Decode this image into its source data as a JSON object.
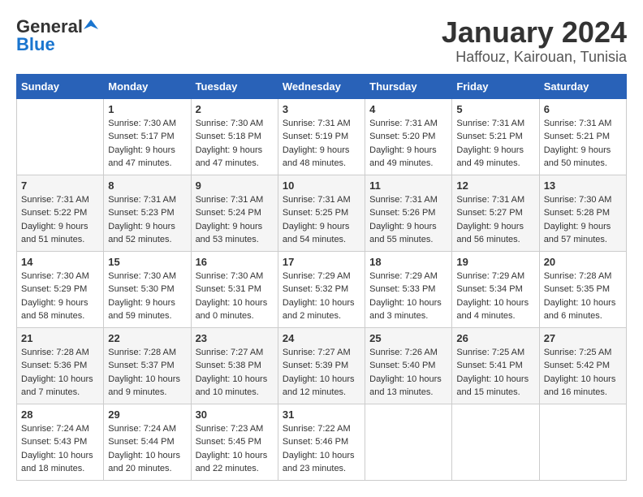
{
  "header": {
    "logo_general": "General",
    "logo_blue": "Blue",
    "month_title": "January 2024",
    "location": "Haffouz, Kairouan, Tunisia"
  },
  "days_of_week": [
    "Sunday",
    "Monday",
    "Tuesday",
    "Wednesday",
    "Thursday",
    "Friday",
    "Saturday"
  ],
  "weeks": [
    [
      {
        "day": "",
        "sunrise": "",
        "sunset": "",
        "daylight": ""
      },
      {
        "day": "1",
        "sunrise": "Sunrise: 7:30 AM",
        "sunset": "Sunset: 5:17 PM",
        "daylight": "Daylight: 9 hours and 47 minutes."
      },
      {
        "day": "2",
        "sunrise": "Sunrise: 7:30 AM",
        "sunset": "Sunset: 5:18 PM",
        "daylight": "Daylight: 9 hours and 47 minutes."
      },
      {
        "day": "3",
        "sunrise": "Sunrise: 7:31 AM",
        "sunset": "Sunset: 5:19 PM",
        "daylight": "Daylight: 9 hours and 48 minutes."
      },
      {
        "day": "4",
        "sunrise": "Sunrise: 7:31 AM",
        "sunset": "Sunset: 5:20 PM",
        "daylight": "Daylight: 9 hours and 49 minutes."
      },
      {
        "day": "5",
        "sunrise": "Sunrise: 7:31 AM",
        "sunset": "Sunset: 5:21 PM",
        "daylight": "Daylight: 9 hours and 49 minutes."
      },
      {
        "day": "6",
        "sunrise": "Sunrise: 7:31 AM",
        "sunset": "Sunset: 5:21 PM",
        "daylight": "Daylight: 9 hours and 50 minutes."
      }
    ],
    [
      {
        "day": "7",
        "sunrise": "Sunrise: 7:31 AM",
        "sunset": "Sunset: 5:22 PM",
        "daylight": "Daylight: 9 hours and 51 minutes."
      },
      {
        "day": "8",
        "sunrise": "Sunrise: 7:31 AM",
        "sunset": "Sunset: 5:23 PM",
        "daylight": "Daylight: 9 hours and 52 minutes."
      },
      {
        "day": "9",
        "sunrise": "Sunrise: 7:31 AM",
        "sunset": "Sunset: 5:24 PM",
        "daylight": "Daylight: 9 hours and 53 minutes."
      },
      {
        "day": "10",
        "sunrise": "Sunrise: 7:31 AM",
        "sunset": "Sunset: 5:25 PM",
        "daylight": "Daylight: 9 hours and 54 minutes."
      },
      {
        "day": "11",
        "sunrise": "Sunrise: 7:31 AM",
        "sunset": "Sunset: 5:26 PM",
        "daylight": "Daylight: 9 hours and 55 minutes."
      },
      {
        "day": "12",
        "sunrise": "Sunrise: 7:31 AM",
        "sunset": "Sunset: 5:27 PM",
        "daylight": "Daylight: 9 hours and 56 minutes."
      },
      {
        "day": "13",
        "sunrise": "Sunrise: 7:30 AM",
        "sunset": "Sunset: 5:28 PM",
        "daylight": "Daylight: 9 hours and 57 minutes."
      }
    ],
    [
      {
        "day": "14",
        "sunrise": "Sunrise: 7:30 AM",
        "sunset": "Sunset: 5:29 PM",
        "daylight": "Daylight: 9 hours and 58 minutes."
      },
      {
        "day": "15",
        "sunrise": "Sunrise: 7:30 AM",
        "sunset": "Sunset: 5:30 PM",
        "daylight": "Daylight: 9 hours and 59 minutes."
      },
      {
        "day": "16",
        "sunrise": "Sunrise: 7:30 AM",
        "sunset": "Sunset: 5:31 PM",
        "daylight": "Daylight: 10 hours and 0 minutes."
      },
      {
        "day": "17",
        "sunrise": "Sunrise: 7:29 AM",
        "sunset": "Sunset: 5:32 PM",
        "daylight": "Daylight: 10 hours and 2 minutes."
      },
      {
        "day": "18",
        "sunrise": "Sunrise: 7:29 AM",
        "sunset": "Sunset: 5:33 PM",
        "daylight": "Daylight: 10 hours and 3 minutes."
      },
      {
        "day": "19",
        "sunrise": "Sunrise: 7:29 AM",
        "sunset": "Sunset: 5:34 PM",
        "daylight": "Daylight: 10 hours and 4 minutes."
      },
      {
        "day": "20",
        "sunrise": "Sunrise: 7:28 AM",
        "sunset": "Sunset: 5:35 PM",
        "daylight": "Daylight: 10 hours and 6 minutes."
      }
    ],
    [
      {
        "day": "21",
        "sunrise": "Sunrise: 7:28 AM",
        "sunset": "Sunset: 5:36 PM",
        "daylight": "Daylight: 10 hours and 7 minutes."
      },
      {
        "day": "22",
        "sunrise": "Sunrise: 7:28 AM",
        "sunset": "Sunset: 5:37 PM",
        "daylight": "Daylight: 10 hours and 9 minutes."
      },
      {
        "day": "23",
        "sunrise": "Sunrise: 7:27 AM",
        "sunset": "Sunset: 5:38 PM",
        "daylight": "Daylight: 10 hours and 10 minutes."
      },
      {
        "day": "24",
        "sunrise": "Sunrise: 7:27 AM",
        "sunset": "Sunset: 5:39 PM",
        "daylight": "Daylight: 10 hours and 12 minutes."
      },
      {
        "day": "25",
        "sunrise": "Sunrise: 7:26 AM",
        "sunset": "Sunset: 5:40 PM",
        "daylight": "Daylight: 10 hours and 13 minutes."
      },
      {
        "day": "26",
        "sunrise": "Sunrise: 7:25 AM",
        "sunset": "Sunset: 5:41 PM",
        "daylight": "Daylight: 10 hours and 15 minutes."
      },
      {
        "day": "27",
        "sunrise": "Sunrise: 7:25 AM",
        "sunset": "Sunset: 5:42 PM",
        "daylight": "Daylight: 10 hours and 16 minutes."
      }
    ],
    [
      {
        "day": "28",
        "sunrise": "Sunrise: 7:24 AM",
        "sunset": "Sunset: 5:43 PM",
        "daylight": "Daylight: 10 hours and 18 minutes."
      },
      {
        "day": "29",
        "sunrise": "Sunrise: 7:24 AM",
        "sunset": "Sunset: 5:44 PM",
        "daylight": "Daylight: 10 hours and 20 minutes."
      },
      {
        "day": "30",
        "sunrise": "Sunrise: 7:23 AM",
        "sunset": "Sunset: 5:45 PM",
        "daylight": "Daylight: 10 hours and 22 minutes."
      },
      {
        "day": "31",
        "sunrise": "Sunrise: 7:22 AM",
        "sunset": "Sunset: 5:46 PM",
        "daylight": "Daylight: 10 hours and 23 minutes."
      },
      {
        "day": "",
        "sunrise": "",
        "sunset": "",
        "daylight": ""
      },
      {
        "day": "",
        "sunrise": "",
        "sunset": "",
        "daylight": ""
      },
      {
        "day": "",
        "sunrise": "",
        "sunset": "",
        "daylight": ""
      }
    ]
  ]
}
